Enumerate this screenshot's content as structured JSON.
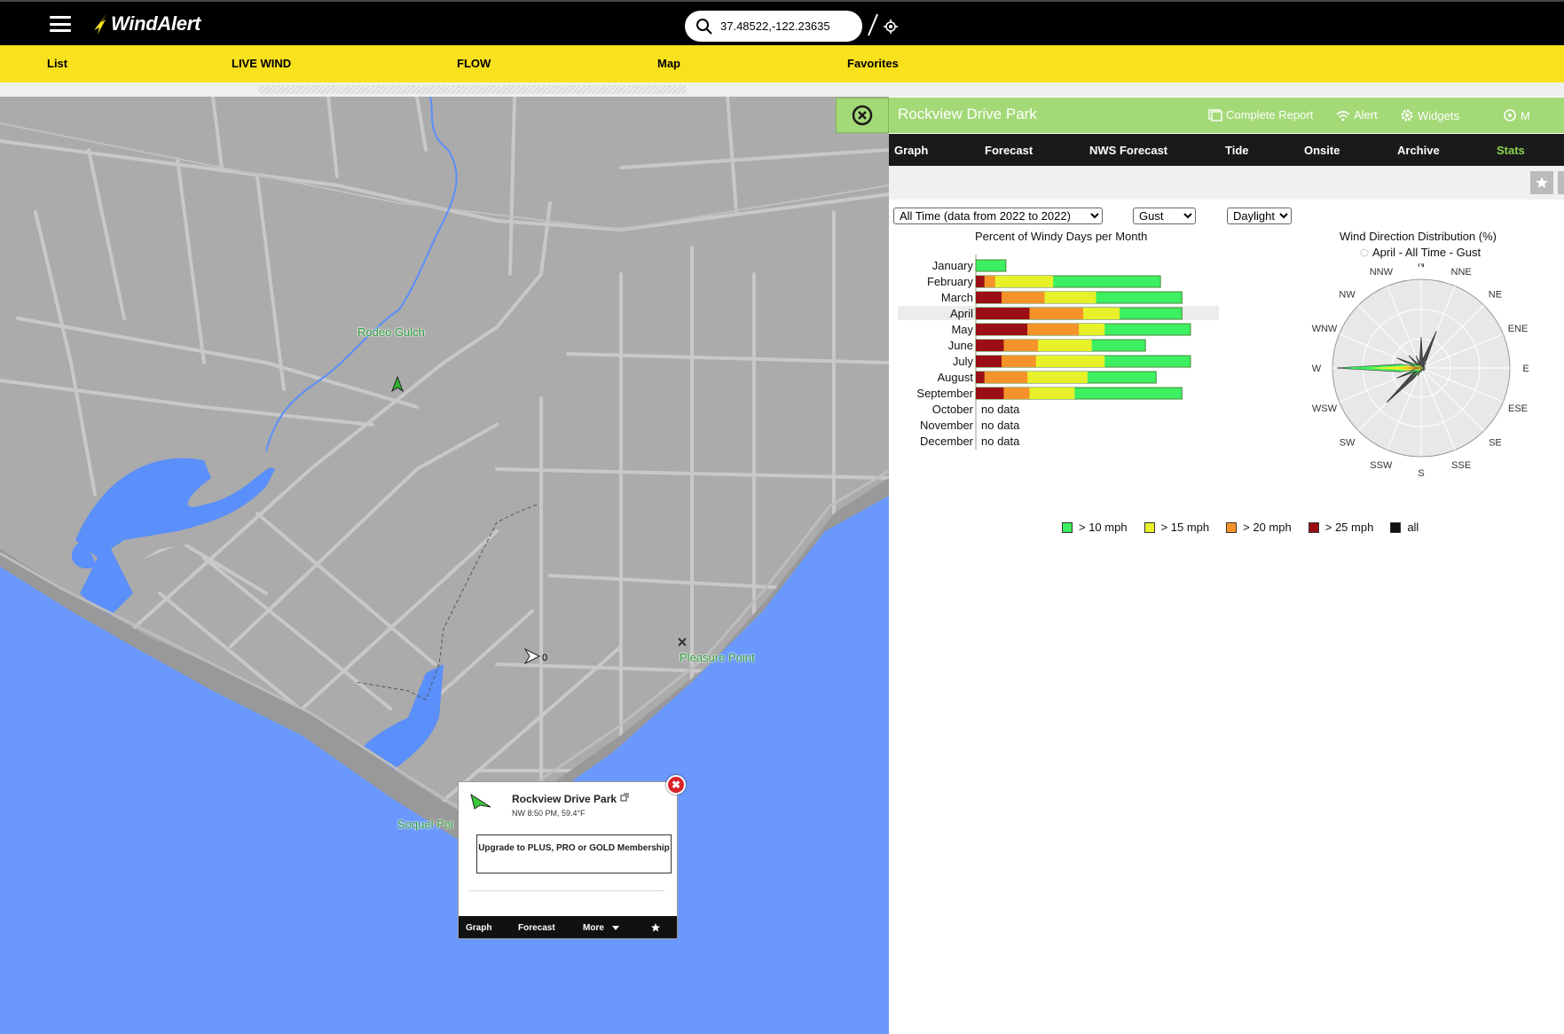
{
  "app": {
    "logo_text": "WindAlert"
  },
  "search": {
    "value": "37.48522,-122.23635"
  },
  "nav": {
    "items": [
      "List",
      "LIVE WIND",
      "FLOW",
      "Map",
      "Favorites"
    ]
  },
  "map": {
    "labels": {
      "rodeo_gulch": "Rodeo Gulch",
      "pleasure_point": "Pleasure Point",
      "soquel_point": "Soquel Poi"
    },
    "marker_value": "0"
  },
  "popup": {
    "title": "Rockview Drive Park",
    "subtitle": "NW 8:50 PM, 59.4°F",
    "upgrade_label": "Upgrade to PLUS, PRO or GOLD Membership",
    "tabs": [
      "Graph",
      "Forecast",
      "More"
    ]
  },
  "panel": {
    "station_name": "Rockview Drive Park",
    "links": [
      "Complete Report",
      "Alert",
      "Widgets",
      "M"
    ],
    "tabs": [
      "Graph",
      "Forecast",
      "NWS Forecast",
      "Tide",
      "Onsite",
      "Archive",
      "Stats"
    ],
    "active_tab": "Stats",
    "filters": {
      "period": "All Time (data from 2022 to 2022)",
      "measure": "Gust",
      "time": "Daylight"
    }
  },
  "colors": {
    "gt10": "#3cf061",
    "gt15": "#e8f02a",
    "gt20": "#f5932a",
    "gt25": "#9b0f14",
    "all": "#111111",
    "accent_green": "#a3d977",
    "brand_yellow": "#f9e11e"
  },
  "chart_data": [
    {
      "type": "bar",
      "title": "Percent of Windy Days per Month",
      "x_ticks": [
        "0",
        "25%",
        "50%",
        "75%",
        "100%"
      ],
      "xlim": [
        0,
        100
      ],
      "highlighted_category": "April",
      "categories": [
        "January",
        "February",
        "March",
        "April",
        "May",
        "June",
        "July",
        "August",
        "September",
        "October",
        "November",
        "December"
      ],
      "series": [
        {
          "name": "> 10 mph",
          "values": [
            14,
            86,
            96,
            96,
            100,
            79,
            100,
            84,
            96,
            null,
            null,
            null
          ]
        },
        {
          "name": "> 15 mph",
          "values": [
            0,
            36,
            56,
            67,
            60,
            54,
            60,
            52,
            46,
            null,
            null,
            null
          ]
        },
        {
          "name": "> 20 mph",
          "values": [
            0,
            9,
            32,
            50,
            48,
            29,
            28,
            24,
            25,
            null,
            null,
            null
          ]
        },
        {
          "name": "> 25 mph",
          "values": [
            0,
            4,
            12,
            25,
            24,
            13,
            12,
            4,
            13,
            null,
            null,
            null
          ]
        }
      ],
      "missing_label": "no data",
      "legend": [
        "> 10 mph",
        "> 15 mph",
        "> 20 mph",
        "> 25 mph",
        "all"
      ]
    },
    {
      "type": "radar",
      "title": "Wind Direction Distribution (%)",
      "subtitle": "April - All Time - Gust",
      "directions": [
        "N",
        "NNE",
        "NE",
        "ENE",
        "E",
        "ESE",
        "SE",
        "SSE",
        "S",
        "SSW",
        "SW",
        "WSW",
        "W",
        "WNW",
        "NW",
        "NNW"
      ],
      "series": [
        {
          "name": "all",
          "values": [
            0.35,
            0.45,
            0.08,
            0.05,
            0.05,
            0.05,
            0.05,
            0.03,
            0.05,
            0.1,
            0.55,
            0.3,
            0.95,
            0.3,
            0.2,
            0.15
          ]
        },
        {
          "name": "> 10 mph",
          "values": [
            0.03,
            0.03,
            0.03,
            0.03,
            0.03,
            0.03,
            0.03,
            0.03,
            0.03,
            0.08,
            0.15,
            0.2,
            0.92,
            0.2,
            0.1,
            0.05
          ]
        },
        {
          "name": "> 15 mph",
          "values": [
            0.02,
            0.02,
            0.02,
            0.02,
            0.02,
            0.02,
            0.02,
            0.02,
            0.02,
            0.04,
            0.07,
            0.1,
            0.6,
            0.1,
            0.06,
            0.03
          ]
        },
        {
          "name": "> 20 mph",
          "values": [
            0.01,
            0.01,
            0.01,
            0.01,
            0.01,
            0.01,
            0.01,
            0.01,
            0.01,
            0.02,
            0.04,
            0.05,
            0.25,
            0.05,
            0.03,
            0.02
          ]
        },
        {
          "name": "> 25 mph",
          "values": [
            0.005,
            0.005,
            0.005,
            0.005,
            0.005,
            0.005,
            0.005,
            0.005,
            0.005,
            0.01,
            0.015,
            0.02,
            0.12,
            0.02,
            0.015,
            0.01
          ]
        }
      ]
    }
  ]
}
